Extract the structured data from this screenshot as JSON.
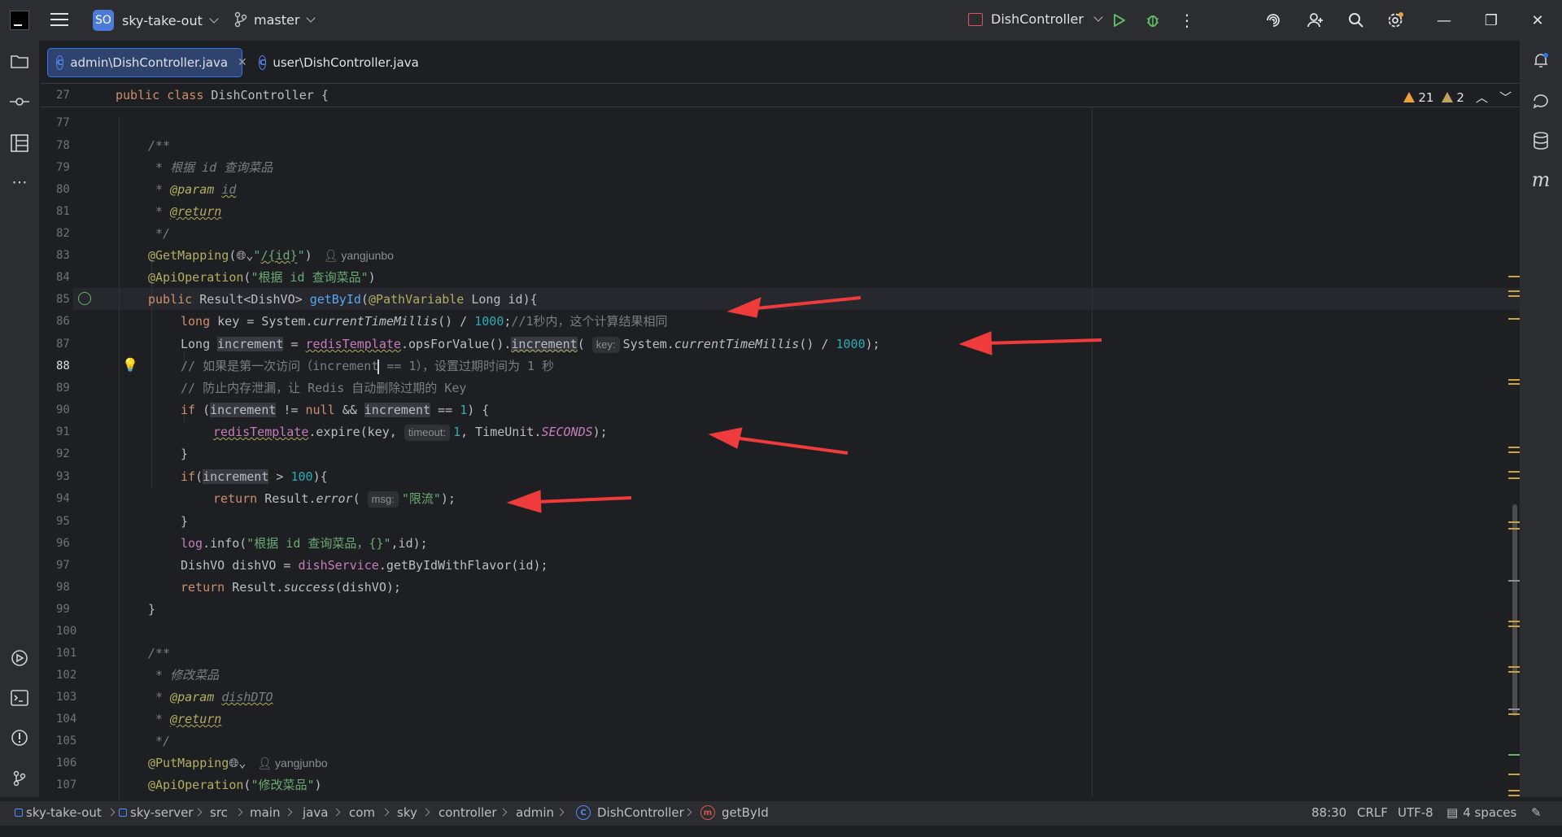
{
  "titlebar": {
    "project_badge": "SO",
    "project_name": "sky-take-out",
    "branch": "master",
    "run_config": "DishController"
  },
  "tabs": [
    {
      "label": "admin\\DishController.java",
      "active": true
    },
    {
      "label": "user\\DishController.java",
      "active": false
    }
  ],
  "sticky": {
    "line": "27",
    "code": "public class DishController {"
  },
  "inspections": {
    "warnings": "21",
    "weak_warnings": "2"
  },
  "code": {
    "l77": "77",
    "l78": "78",
    "l79": "79",
    "l80": "80",
    "l81": "81",
    "l82": "82",
    "l83": "83",
    "l84": "84",
    "l85": "85",
    "l86": "86",
    "l87": "87",
    "l88": "88",
    "l89": "89",
    "l90": "90",
    "l91": "91",
    "l92": "92",
    "l93": "93",
    "l94": "94",
    "l95": "95",
    "l96": "96",
    "l97": "97",
    "l98": "98",
    "l99": "99",
    "l100": "100",
    "l101": "101",
    "l102": "102",
    "l103": "103",
    "l104": "104",
    "l105": "105",
    "l106": "106",
    "l107": "107",
    "c79": " * 根据 id 查询菜品",
    "c84_str": "\"根据 id 查询菜品\"",
    "c86_cmt": "//1秒内，这个计算结果相同",
    "c88": "// 如果是第一次访问（increment",
    "c88b": " == 1），设置过期时间为 1 秒",
    "c89": "// 防止内存泄漏，让 Redis 自动删除过期的 Key",
    "c94_str": "\"限流\"",
    "c96_str": "\"根据 id 查询菜品，{}\"",
    "c102": " * 修改菜品",
    "c107_str": "\"修改菜品\"",
    "author": "yangjunbo",
    "hint_key": "key:",
    "hint_timeout": "timeout:",
    "hint_msg": "msg:"
  },
  "statusbar": {
    "crumbs": [
      "sky-take-out",
      "sky-server",
      "src",
      "main",
      "java",
      "com",
      "sky",
      "controller",
      "admin",
      "DishController",
      "getById"
    ],
    "position": "88:30",
    "line_sep": "CRLF",
    "encoding": "UTF-8",
    "indent": "4 spaces"
  }
}
